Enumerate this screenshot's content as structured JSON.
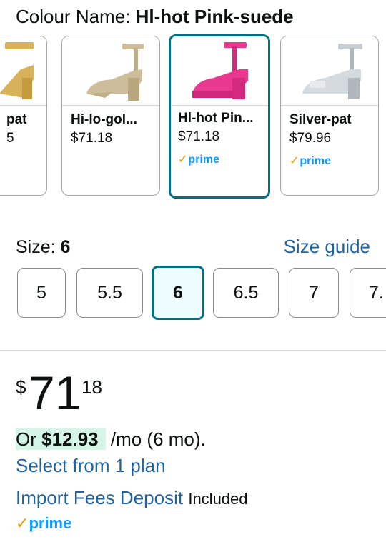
{
  "colour": {
    "label": "Colour Name: ",
    "value": "Hl-hot Pink-suede"
  },
  "swatches": [
    {
      "name": "pat",
      "price": "5",
      "prime": false,
      "shoe_color": "#d8b25a"
    },
    {
      "name": "Hi-lo-gol...",
      "price": "$71.18",
      "prime": false,
      "shoe_color": "#cdbd9a"
    },
    {
      "name": "Hl-hot Pin...",
      "price": "$71.18",
      "prime": true,
      "shoe_color": "#e8388f"
    },
    {
      "name": "Silver-pat",
      "price": "$79.96",
      "prime": true,
      "shoe_color": "#c9ced3"
    }
  ],
  "prime_text": "prime",
  "size": {
    "label": "Size: ",
    "value": "6",
    "guide": "Size guide",
    "options": [
      "5",
      "5.5",
      "6",
      "6.5",
      "7",
      "7."
    ]
  },
  "price": {
    "symbol": "$",
    "whole": "71",
    "fraction": "18"
  },
  "installment": {
    "prefix": "Or ",
    "amount": "$12.93",
    "suffix": " /mo (6 mo).",
    "select_plan": "Select from 1 plan"
  },
  "import_fees": {
    "link": "Import Fees Deposit",
    "included": "Included"
  },
  "colors": {
    "selected_border": "#007185",
    "link": "#2162a1",
    "prime_blue": "#1399ff",
    "prime_check": "#f29a00",
    "installment_highlight": "#d5f5e7"
  }
}
